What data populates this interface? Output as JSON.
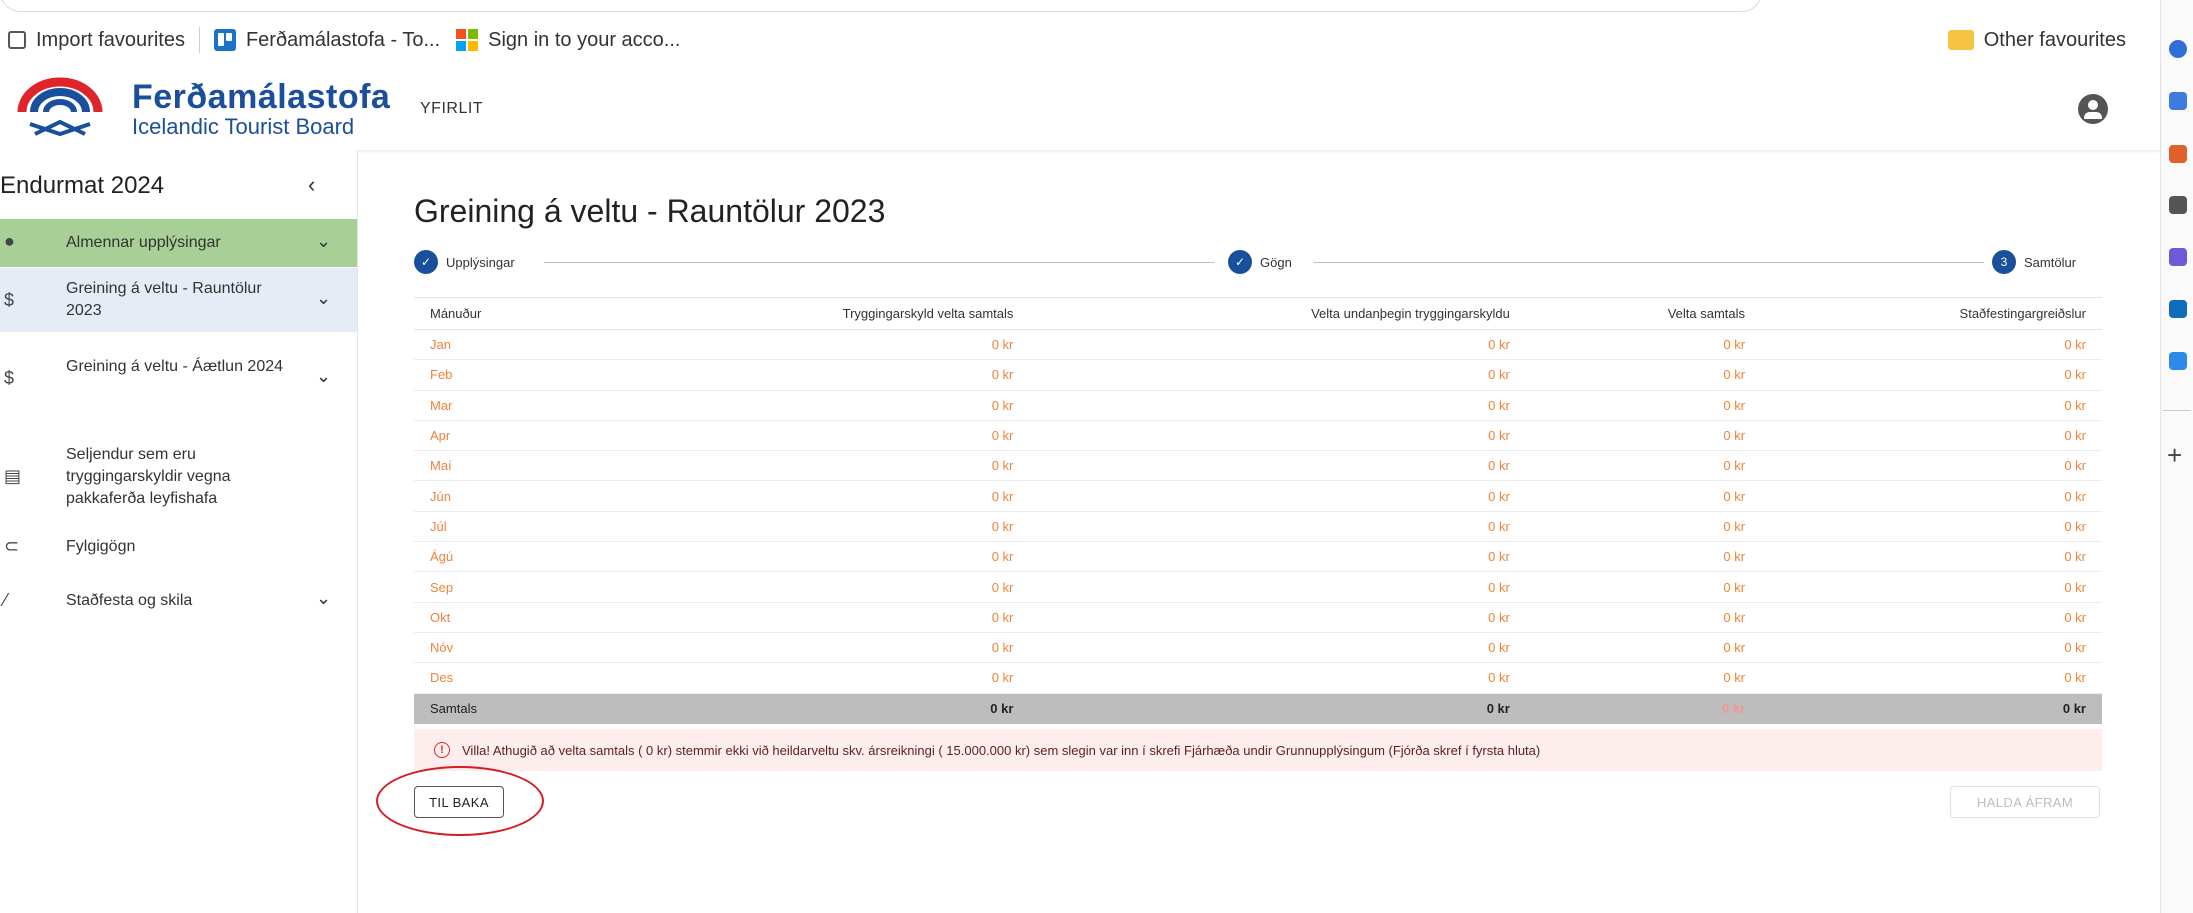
{
  "browser": {
    "bookmarks": [
      {
        "label": "Import favourites",
        "icon": "import-icon"
      },
      {
        "label": "Ferðamálastofa - To...",
        "icon": "trello-icon"
      },
      {
        "label": "Sign in to your acco...",
        "icon": "microsoft-icon"
      }
    ],
    "other_favourites": "Other favourites"
  },
  "header": {
    "logo_name": "Ferðamálastofa",
    "logo_sub": "Icelandic Tourist Board",
    "nav_overview": "YFIRLIT"
  },
  "sidebar": {
    "title": "Endurmat 2024",
    "collapse_glyph": "‹",
    "items": [
      {
        "label": "Almennar upplýsingar",
        "icon": "info-icon",
        "glyph": "●",
        "chevron": true
      },
      {
        "label": "Greining á veltu - Rauntölur 2023",
        "icon": "dollar-icon",
        "glyph": "$",
        "chevron": true
      },
      {
        "label": "Greining á veltu - Áætlun 2024",
        "icon": "dollar-icon",
        "glyph": "$",
        "chevron": true
      },
      {
        "label": "Seljendur sem eru tryggingarskyldir vegna pakkaferða leyfishafa",
        "icon": "receipt-icon",
        "glyph": "▤",
        "chevron": false
      },
      {
        "label": "Fylgigögn",
        "icon": "paperclip-icon",
        "glyph": "⊂",
        "chevron": false
      },
      {
        "label": "Staðfesta og skila",
        "icon": "pencil-icon",
        "glyph": "⁄",
        "chevron": true
      }
    ]
  },
  "main": {
    "title": "Greining á veltu - Rauntölur 2023",
    "steps": [
      {
        "label": "Upplýsingar",
        "marker": "✓"
      },
      {
        "label": "Gögn",
        "marker": "✓"
      },
      {
        "label": "Samtölur",
        "marker": "3"
      }
    ],
    "table": {
      "headers": [
        "Mánuður",
        "Tryggingarskyld velta samtals",
        "Velta undanþegin tryggingarskyldu",
        "Velta samtals",
        "Staðfestingargreiðslur"
      ],
      "rows": [
        [
          "Jan",
          "0 kr",
          "0 kr",
          "0 kr",
          "0 kr"
        ],
        [
          "Feb",
          "0 kr",
          "0 kr",
          "0 kr",
          "0 kr"
        ],
        [
          "Mar",
          "0 kr",
          "0 kr",
          "0 kr",
          "0 kr"
        ],
        [
          "Apr",
          "0 kr",
          "0 kr",
          "0 kr",
          "0 kr"
        ],
        [
          "Maí",
          "0 kr",
          "0 kr",
          "0 kr",
          "0 kr"
        ],
        [
          "Jún",
          "0 kr",
          "0 kr",
          "0 kr",
          "0 kr"
        ],
        [
          "Júl",
          "0 kr",
          "0 kr",
          "0 kr",
          "0 kr"
        ],
        [
          "Ágú",
          "0 kr",
          "0 kr",
          "0 kr",
          "0 kr"
        ],
        [
          "Sep",
          "0 kr",
          "0 kr",
          "0 kr",
          "0 kr"
        ],
        [
          "Okt",
          "0 kr",
          "0 kr",
          "0 kr",
          "0 kr"
        ],
        [
          "Nóv",
          "0 kr",
          "0 kr",
          "0 kr",
          "0 kr"
        ],
        [
          "Des",
          "0 kr",
          "0 kr",
          "0 kr",
          "0 kr"
        ]
      ],
      "total": [
        "Samtals",
        "0 kr",
        "0 kr",
        "0 kr",
        "0 kr"
      ]
    },
    "alert": "Villa! Athugið að velta samtals ( 0 kr) stemmir ekki við heildarveltu skv. ársreikningi ( 15.000.000 kr) sem slegin var inn í skrefi Fjárhæða undir Grunnupplýsingum (Fjórða skref í fyrsta hluta)",
    "back_button": "TIL BAKA",
    "next_button": "HALDA ÁFRAM"
  },
  "colors": {
    "brand_blue": "#1a4f9c",
    "active_sidebar": "#a8cf96",
    "amount_orange": "#f0833a",
    "alert_bg": "#fdeded",
    "annotation_red": "#d41d23"
  }
}
